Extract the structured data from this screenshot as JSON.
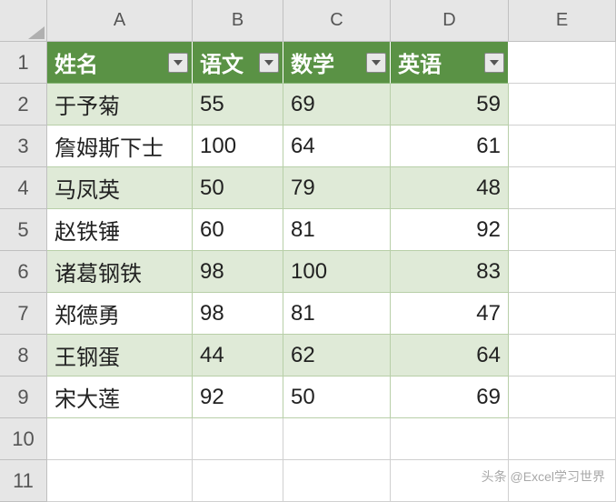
{
  "columns": [
    "A",
    "B",
    "C",
    "D",
    "E"
  ],
  "row_numbers": [
    1,
    2,
    3,
    4,
    5,
    6,
    7,
    8,
    9,
    10,
    11
  ],
  "headers": {
    "name": "姓名",
    "chinese": "语文",
    "math": "数学",
    "english": "英语"
  },
  "rows": [
    {
      "name": "于予菊",
      "chinese": 55,
      "math": 69,
      "english": 59
    },
    {
      "name": "詹姆斯下士",
      "chinese": 100,
      "math": 64,
      "english": 61
    },
    {
      "name": "马凤英",
      "chinese": 50,
      "math": 79,
      "english": 48
    },
    {
      "name": "赵铁锤",
      "chinese": 60,
      "math": 81,
      "english": 92
    },
    {
      "name": "诸葛钢铁",
      "chinese": 98,
      "math": 100,
      "english": 83
    },
    {
      "name": "郑德勇",
      "chinese": 98,
      "math": 81,
      "english": 47
    },
    {
      "name": "王钢蛋",
      "chinese": 44,
      "math": 62,
      "english": 64
    },
    {
      "name": "宋大莲",
      "chinese": 92,
      "math": 50,
      "english": 69
    }
  ],
  "watermark": "头条 @Excel学习世界"
}
